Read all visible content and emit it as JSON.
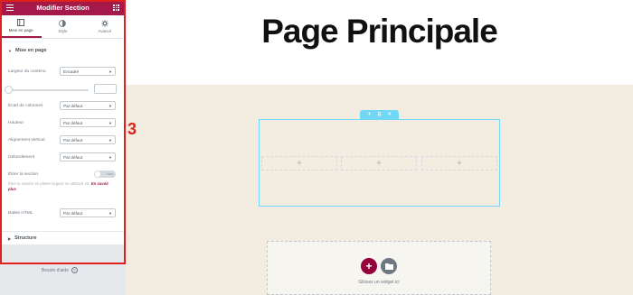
{
  "panel": {
    "title": "Modifier Section",
    "tabs": [
      {
        "label": "Mise en page",
        "icon": "layout-icon",
        "active": true
      },
      {
        "label": "Style",
        "icon": "contrast-icon",
        "active": false
      },
      {
        "label": "Avancé",
        "icon": "gear-icon",
        "active": false
      }
    ],
    "section_layout_title": "Mise en page",
    "controls": {
      "content_width": {
        "label": "Largeur du contenu",
        "value": "Encadré"
      },
      "column_gap": {
        "label": "Écart de colonnes",
        "value": "Par défaut"
      },
      "height": {
        "label": "Hauteur",
        "value": "Par défaut"
      },
      "vertical_align": {
        "label": "Alignement vertical",
        "value": "Par défaut"
      },
      "overflow": {
        "label": "Débordement",
        "value": "Par défaut"
      },
      "stretch_section": {
        "label": "Étirer la section",
        "value": "Non"
      },
      "html_tag": {
        "label": "Balise HTML",
        "value": "Par défaut"
      }
    },
    "stretch_description": "Étire la section en pleine largeur en utilisant JS.",
    "learn_more": "En savoir plus",
    "section_structure_title": "Structure",
    "help_text": "Besoin d'aide",
    "accent_color": "#a4194a"
  },
  "annotation": {
    "step_number": "3",
    "color": "#e0201b"
  },
  "canvas": {
    "page_title": "Page Principale",
    "section_handle": {
      "add": "+",
      "move": "⠿",
      "remove": "×"
    },
    "columns": [
      "+",
      "+",
      "+"
    ],
    "dropzone_text": "Glissez un widget ici",
    "add_button": "+",
    "background_color": "#f2ede0",
    "section_outline_color": "#71d7f7"
  }
}
